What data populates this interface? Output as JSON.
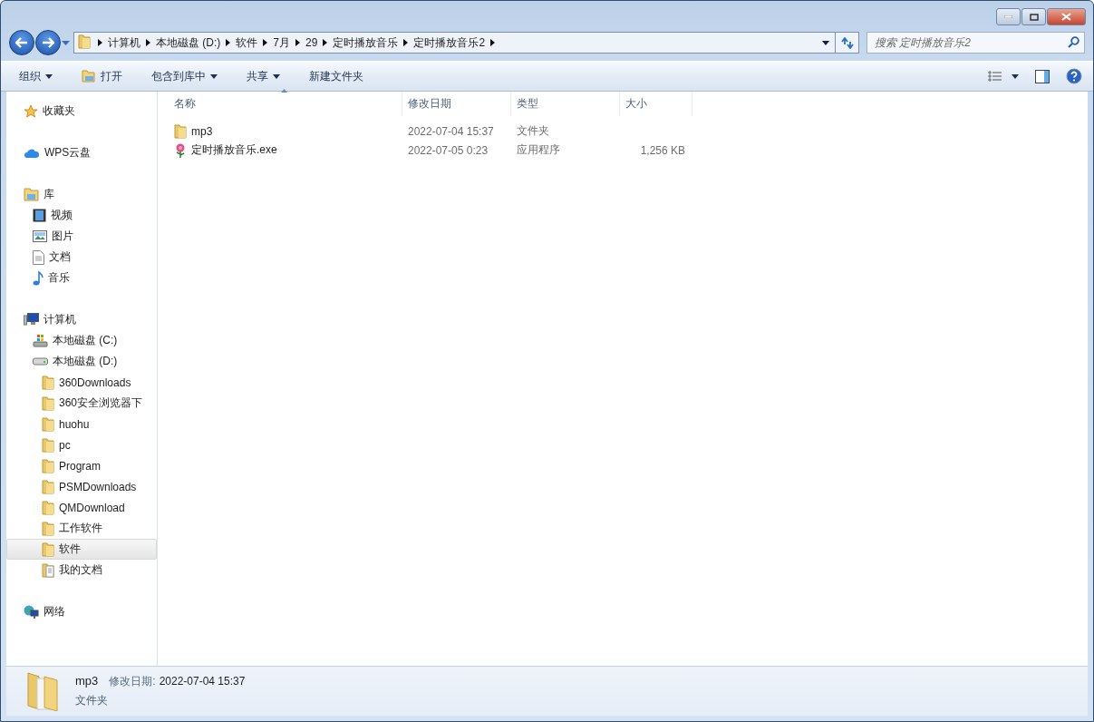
{
  "address_bar": {
    "crumbs": [
      "计算机",
      "本地磁盘 (D:)",
      "软件",
      "7月",
      "29",
      "定时播放音乐",
      "定时播放音乐2"
    ]
  },
  "search": {
    "placeholder": "搜索 定时播放音乐2"
  },
  "toolbar": {
    "buttons": [
      {
        "label": "组织",
        "kind": "menu"
      },
      {
        "label": "打开",
        "kind": "open"
      },
      {
        "label": "包含到库中",
        "kind": "menu"
      },
      {
        "label": "共享",
        "kind": "menu"
      },
      {
        "label": "新建文件夹",
        "kind": "plain"
      }
    ]
  },
  "sidebar": {
    "items": [
      {
        "label": "收藏夹",
        "kind": "star",
        "selected": false
      },
      {
        "label": "WPS云盘",
        "kind": "cloud",
        "selected": false
      },
      {
        "label": "库",
        "kind": "library",
        "selected": false,
        "children": [
          {
            "label": "视频",
            "kind": "video",
            "selected": false
          },
          {
            "label": "图片",
            "kind": "picture",
            "selected": false
          },
          {
            "label": "文档",
            "kind": "document",
            "selected": false
          },
          {
            "label": "音乐",
            "kind": "music",
            "selected": false
          }
        ]
      },
      {
        "label": "计算机",
        "kind": "computer",
        "selected": false,
        "children": [
          {
            "label": "本地磁盘 (C:)",
            "kind": "system-drive",
            "selected": false
          },
          {
            "label": "本地磁盘 (D:)",
            "kind": "drive",
            "selected": false,
            "children": [
              {
                "label": "360Downloads",
                "kind": "folder",
                "selected": false
              },
              {
                "label": "360安全浏览器下",
                "kind": "folder",
                "selected": false
              },
              {
                "label": "huohu",
                "kind": "folder",
                "selected": false
              },
              {
                "label": "pc",
                "kind": "folder",
                "selected": false
              },
              {
                "label": "Program",
                "kind": "folder",
                "selected": false
              },
              {
                "label": "PSMDownloads",
                "kind": "folder",
                "selected": false
              },
              {
                "label": "QMDownload",
                "kind": "folder",
                "selected": false
              },
              {
                "label": "工作软件",
                "kind": "folder",
                "selected": false
              },
              {
                "label": "软件",
                "kind": "folder",
                "selected": true
              },
              {
                "label": "我的文档",
                "kind": "doc-folder",
                "selected": false
              }
            ]
          }
        ]
      },
      {
        "label": "网络",
        "kind": "network",
        "selected": false
      }
    ]
  },
  "file_list": {
    "columns": [
      "名称",
      "修改日期",
      "类型",
      "大小"
    ],
    "rows": [
      {
        "name": "mp3",
        "kind": "folder",
        "date": "2022-07-04 15:37",
        "type": "文件夹"
      },
      {
        "name": "定时播放音乐.exe",
        "kind": "flower",
        "date": "2022-07-05 0:23",
        "type": "应用程序",
        "size": "1,256 KB"
      }
    ]
  },
  "details_pane": {
    "name": "mp3",
    "date_label": "修改日期:",
    "date": "2022-07-04 15:37",
    "type": "文件夹"
  }
}
